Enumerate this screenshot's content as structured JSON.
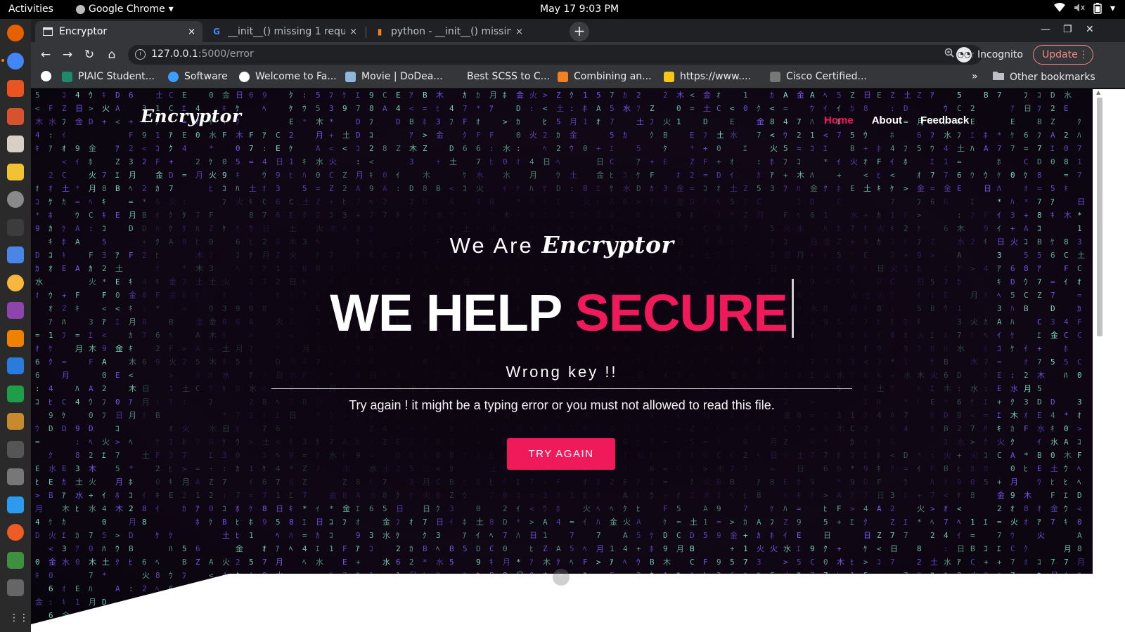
{
  "system_bar": {
    "activities": "Activities",
    "app_name": "Google Chrome",
    "clock": "May 17  9:03 PM",
    "icons": [
      "wifi-icon",
      "volume-icon",
      "battery-icon",
      "power-menu-icon"
    ]
  },
  "dock": {
    "apps": [
      {
        "name": "firefox",
        "color": "#e66000"
      },
      {
        "name": "chrome",
        "color": "#4285f4"
      },
      {
        "name": "software-center",
        "color": "#e95420"
      },
      {
        "name": "libreoffice-impress",
        "color": "#d8522d"
      },
      {
        "name": "files",
        "color": "#d7d0c7"
      },
      {
        "name": "text-editor",
        "color": "#f1c232"
      },
      {
        "name": "settings",
        "color": "#8a8a8a"
      },
      {
        "name": "terminal",
        "color": "#3c3c3c"
      },
      {
        "name": "notes",
        "color": "#4a86e8"
      },
      {
        "name": "rhythmbox",
        "color": "#f6b73c"
      },
      {
        "name": "videos",
        "color": "#8e44ad"
      },
      {
        "name": "vlc",
        "color": "#f08000"
      },
      {
        "name": "writer",
        "color": "#2a7bde"
      },
      {
        "name": "calc",
        "color": "#1f9e4a"
      },
      {
        "name": "archive",
        "color": "#c88a2e"
      },
      {
        "name": "system-monitor",
        "color": "#555555"
      },
      {
        "name": "screenshot",
        "color": "#777777"
      },
      {
        "name": "vscode",
        "color": "#2c9bef"
      },
      {
        "name": "postman",
        "color": "#ef5b25"
      },
      {
        "name": "minecraft",
        "color": "#3f8f3f"
      },
      {
        "name": "misc",
        "color": "#666666"
      }
    ],
    "show_apps": "⋮⋮⋮"
  },
  "tabs": [
    {
      "title": "Encryptor",
      "close": "×",
      "active": true
    },
    {
      "title": "__init__() missing 1 requir",
      "close": "×",
      "active": false
    },
    {
      "title": "python - __init__() missing",
      "close": "×",
      "active": false
    }
  ],
  "new_tab": "+",
  "window_controls": {
    "minimize": "—",
    "maximize": "❐",
    "close": "✕"
  },
  "toolbar": {
    "back": "←",
    "forward": "→",
    "reload": "↻",
    "home": "⌂",
    "url_host": "127.0.0.1",
    "url_path": ":5000/error",
    "profile": "Incognito",
    "update": "Update",
    "menu": "⋮"
  },
  "bookmarks": [
    {
      "label": "",
      "icon_color": "#ffffff"
    },
    {
      "label": "PIAIC Student...",
      "icon_color": "#1c8a6b"
    },
    {
      "label": "Software",
      "icon_color": "#3aa0ff"
    },
    {
      "label": "Welcome to Fa...",
      "icon_color": "#ffffff"
    },
    {
      "label": "Movie | DoDea...",
      "icon_color": "#8fb7d9"
    },
    {
      "label": "Best SCSS to C...",
      "icon_color": "#35363a"
    },
    {
      "label": "Combining an...",
      "icon_color": "#f48024"
    },
    {
      "label": "https://www....",
      "icon_color": "#f5c518"
    },
    {
      "label": "Cisco Certified...",
      "icon_color": "#777777"
    }
  ],
  "bookmarks_overflow": "»",
  "other_bookmarks": "Other bookmarks",
  "page": {
    "logo": "Encryptor",
    "nav": {
      "home": "Home",
      "about": "About",
      "feedback": "Feedback"
    },
    "intro_prefix": "We Are",
    "intro_brand": "Encryptor",
    "headline_plain": "WE HELP",
    "headline_accent": "SECURE",
    "error_title": "Wrong key !!",
    "error_message": "Try again ! it might be a typing error or you must not allowed to read this file.",
    "button": "TRY AGAIN",
    "scroll_up": "⌃",
    "colors": {
      "accent": "#f01a5b",
      "rain": "#7fe3c5",
      "rain_purple": "#7a5cff"
    }
  }
}
